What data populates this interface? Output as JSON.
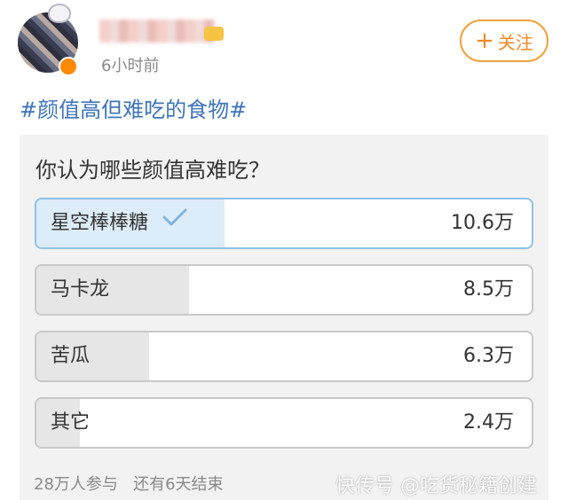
{
  "post": {
    "time": "6小时前",
    "follow_label": "关注",
    "hashtag": "#颜值高但难吃的食物#"
  },
  "poll": {
    "question": "你认为哪些颜值高难吃？",
    "options": [
      {
        "label": "星空棒棒糖",
        "count": "10.6万",
        "selected": true,
        "fill": 1.0
      },
      {
        "label": "马卡龙",
        "count": "8.5万",
        "selected": false,
        "fill": 0.8
      },
      {
        "label": "苦瓜",
        "count": "6.3万",
        "selected": false,
        "fill": 0.59
      },
      {
        "label": "其它",
        "count": "2.4万",
        "selected": false,
        "fill": 0.23
      }
    ],
    "participants": "28万人参与",
    "remaining": "还有6天结束"
  },
  "watermark": "快传号 @吃货秘籍创建",
  "colors": {
    "accent_orange": "#f08a24",
    "hashtag_blue": "#3f74b8",
    "selected_border": "#8ec2ea",
    "selected_fill": "#dcecf8",
    "check_blue": "#7fb4e0"
  },
  "icons": [
    "plus-icon",
    "checkmark-icon"
  ]
}
